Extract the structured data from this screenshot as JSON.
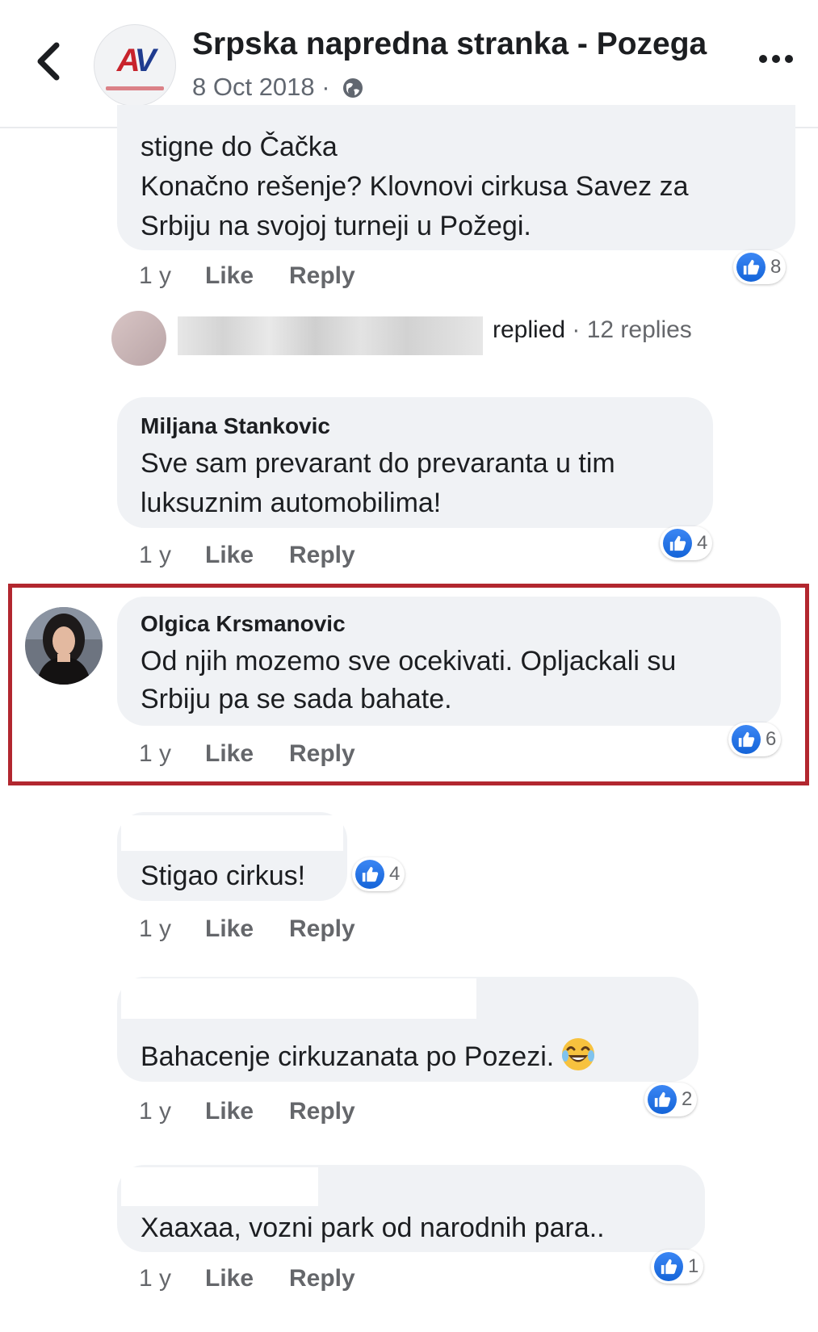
{
  "header": {
    "page_name": "Srpska napredna stranka - Pozega",
    "date": "8 Oct 2018",
    "separator": " · ",
    "avatar_letters_a": "A",
    "avatar_letters_v": "V"
  },
  "comments": [
    {
      "lines": [
        "stigne do Čačka",
        "Konačno rešenje? Klovnovi cirkusa Savez za",
        "Srbiju na svojoj turneji u Požegi."
      ],
      "time": "1 y",
      "like": "Like",
      "reply": "Reply",
      "reactions": "8"
    },
    {
      "author": "Miljana Stankovic",
      "lines": [
        "Sve sam prevarant do prevaranta u tim",
        "luksuznim automobilima!"
      ],
      "time": "1 y",
      "like": "Like",
      "reply": "Reply",
      "reactions": "4"
    },
    {
      "author": "Olgica Krsmanovic",
      "lines": [
        "Od njih mozemo sve ocekivati. Opljackali su",
        "Srbiju pa se sada bahate."
      ],
      "time": "1 y",
      "like": "Like",
      "reply": "Reply",
      "reactions": "6"
    },
    {
      "lines": [
        "Stigao cirkus!"
      ],
      "time": "1 y",
      "like": "Like",
      "reply": "Reply",
      "reactions": "4"
    },
    {
      "lines": [
        "Bahacenje cirkuzanata po Pozezi."
      ],
      "time": "1 y",
      "like": "Like",
      "reply": "Reply",
      "reactions": "2"
    },
    {
      "lines": [
        "Xaaxaa, vozni park od narodnih para.."
      ],
      "time": "1 y",
      "like": "Like",
      "reply": "Reply",
      "reactions": "1"
    }
  ],
  "replies_summary": {
    "replied": "replied",
    "count": " · 12 replies"
  },
  "colors": {
    "highlight_border": "#b2272f",
    "bubble_bg": "#f0f2f5",
    "like_blue": "#1877f2"
  },
  "icons": [
    "back-arrow-icon",
    "globe-icon",
    "more-icon",
    "like-icon",
    "laughing-emoji-icon"
  ]
}
